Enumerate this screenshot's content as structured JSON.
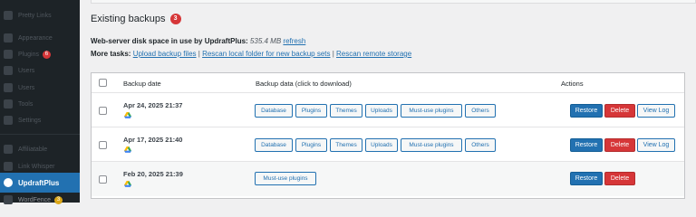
{
  "sidebar": {
    "items": [
      {
        "label": "Pretty Links",
        "badge": ""
      },
      {
        "label": "Appearance",
        "badge": ""
      },
      {
        "label": "Plugins",
        "badge": "6"
      },
      {
        "label": "Users",
        "badge": ""
      },
      {
        "label": "Users",
        "badge": ""
      },
      {
        "label": "Tools",
        "badge": ""
      },
      {
        "label": "Settings",
        "badge": ""
      },
      {
        "label": "Affiliatable",
        "badge": ""
      },
      {
        "label": "Link Whisper",
        "badge": ""
      }
    ],
    "active": {
      "label": "UpdraftPlus"
    },
    "below": {
      "label": "WordFence",
      "badge": "3"
    }
  },
  "heading": {
    "title": "Existing backups",
    "count": "3"
  },
  "disk": {
    "label": "Web-server disk space in use by UpdraftPlus:",
    "value": "535.4 MB",
    "refresh": "refresh"
  },
  "tasks": {
    "label": "More tasks:",
    "upload": "Upload backup files",
    "rescan_local": "Rescan local folder for new backup sets",
    "rescan_remote": "Rescan remote storage",
    "separator": "|"
  },
  "table": {
    "headers": {
      "date": "Backup date",
      "data": "Backup data (click to download)",
      "actions": "Actions"
    },
    "rows": [
      {
        "date": "Apr 24, 2025 21:37",
        "items": [
          "Database",
          "Plugins",
          "Themes",
          "Uploads",
          "Must-use plugins",
          "Others"
        ],
        "restore": "Restore",
        "delete": "Delete",
        "viewlog": "View Log"
      },
      {
        "date": "Apr 17, 2025 21:40",
        "items": [
          "Database",
          "Plugins",
          "Themes",
          "Uploads",
          "Must-use plugins",
          "Others"
        ],
        "restore": "Restore",
        "delete": "Delete",
        "viewlog": "View Log"
      },
      {
        "date": "Feb 20, 2025 21:39",
        "items": [
          "Must-use plugins"
        ],
        "restore": "Restore",
        "delete": "Delete"
      }
    ]
  },
  "colors": {
    "accent": "#2271b1",
    "danger": "#d63638",
    "sidebar": "#1d2327"
  },
  "icons": {
    "storage": "google-drive-icon"
  }
}
